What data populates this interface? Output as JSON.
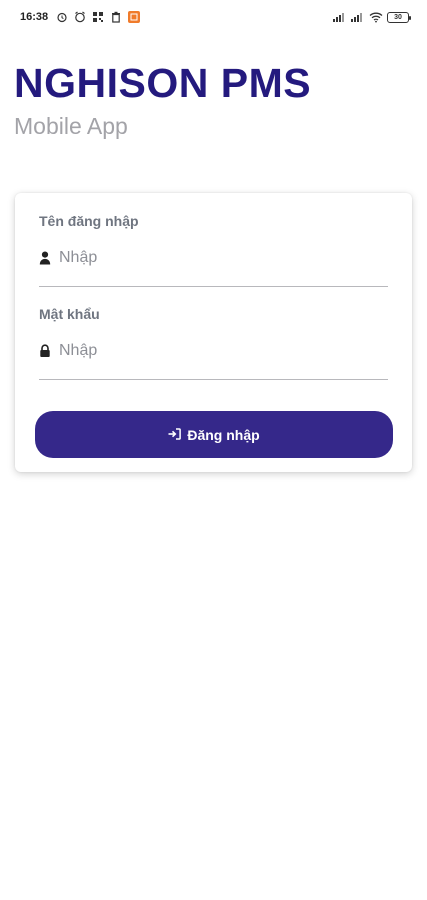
{
  "status_bar": {
    "time": "16:38",
    "battery": "30",
    "icons": [
      "alarm-icon",
      "clock-icon",
      "qr-icon",
      "trash-icon",
      "notification-icon",
      "signal-icon",
      "signal-icon",
      "wifi-icon",
      "battery-icon"
    ]
  },
  "header": {
    "title": "NGHISON PMS",
    "subtitle": "Mobile App"
  },
  "form": {
    "username": {
      "label": "Tên đăng nhập",
      "placeholder": "Nhập",
      "icon": "user-icon"
    },
    "password": {
      "label": "Mật khẩu",
      "placeholder": "Nhập",
      "icon": "lock-icon"
    },
    "submit": {
      "label": "Đăng nhập",
      "icon": "sign-in-icon"
    }
  },
  "colors": {
    "brand": "#241a7e",
    "button": "#35288a",
    "subtitle": "#a3a3a8",
    "label": "#6f7580"
  }
}
